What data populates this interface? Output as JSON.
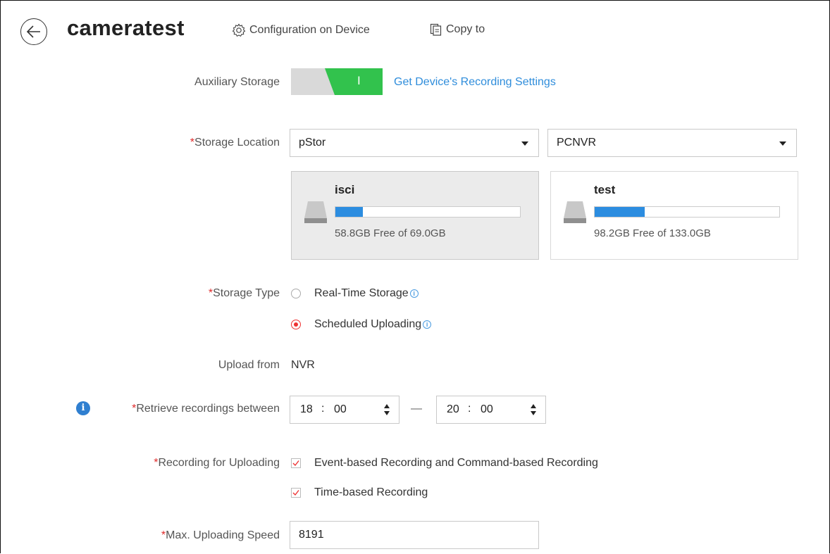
{
  "header": {
    "title": "cameratest",
    "config_label": "Configuration on Device",
    "copy_label": "Copy to"
  },
  "auxiliary_storage": {
    "label": "Auxiliary Storage",
    "enabled": true,
    "toggle_mark": "I",
    "link": "Get Device's Recording Settings"
  },
  "storage_location": {
    "required_mark": "*",
    "label": "Storage Location",
    "select1_value": "pStor",
    "select2_value": "PCNVR",
    "cards": [
      {
        "name": "isci",
        "free_text": "58.8GB Free of 69.0GB",
        "used_fraction": 0.15,
        "selected": true
      },
      {
        "name": "test",
        "free_text": "98.2GB Free of 133.0GB",
        "used_fraction": 0.27,
        "selected": false
      }
    ]
  },
  "storage_type": {
    "required_mark": "*",
    "label": "Storage Type",
    "options": [
      {
        "label": "Real-Time Storage",
        "checked": false
      },
      {
        "label": "Scheduled Uploading",
        "checked": true
      }
    ],
    "info_glyph": "i"
  },
  "upload_from": {
    "label": "Upload from",
    "value": "NVR"
  },
  "retrieve": {
    "info_glyph": "i",
    "required_mark": "*",
    "label": "Retrieve recordings between",
    "start": {
      "hh": "18",
      "mm": "00"
    },
    "separator": "—",
    "end": {
      "hh": "20",
      "mm": "00"
    },
    "colon": ":"
  },
  "recording_for_uploading": {
    "required_mark": "*",
    "label": "Recording for Uploading",
    "options": [
      {
        "label": "Event-based Recording and Command-based Recording",
        "checked": true
      },
      {
        "label": "Time-based Recording",
        "checked": true
      }
    ]
  },
  "max_speed": {
    "required_mark": "*",
    "label": "Max. Uploading Speed",
    "value": "8191"
  },
  "colors": {
    "accent_blue": "#2f8ddb",
    "toggle_green": "#32c24d",
    "required_red": "#e02b2b",
    "bar_blue": "#2c8de0"
  }
}
